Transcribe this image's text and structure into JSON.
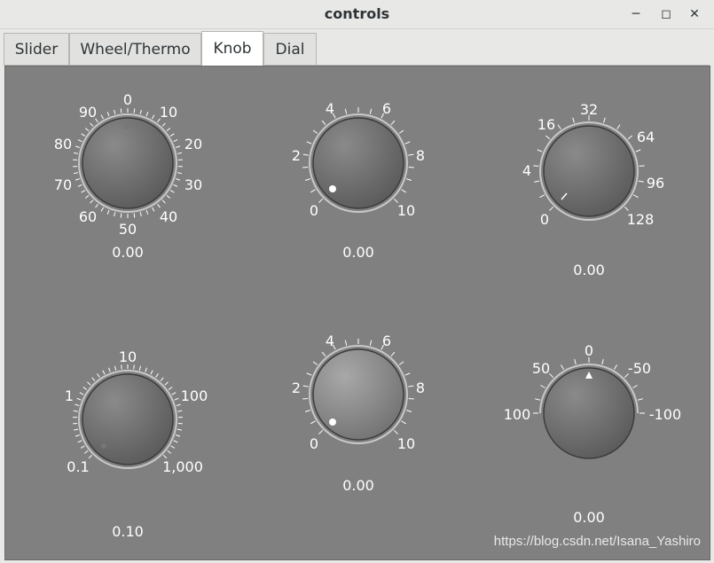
{
  "window": {
    "title": "controls",
    "minimize_icon": "minimize-icon",
    "maximize_icon": "maximize-icon",
    "close_icon": "close-icon"
  },
  "tabs": [
    {
      "label": "Slider",
      "active": false
    },
    {
      "label": "Wheel/Thermo",
      "active": false
    },
    {
      "label": "Knob",
      "active": true
    },
    {
      "label": "Dial",
      "active": false
    }
  ],
  "knobs": [
    {
      "value_text": "0.00",
      "scale_labels": [
        "0",
        "10",
        "20",
        "30",
        "40",
        "50",
        "60",
        "70",
        "80",
        "90"
      ]
    },
    {
      "value_text": "0.00",
      "scale_labels": [
        "0",
        "2",
        "4",
        "6",
        "8",
        "10"
      ]
    },
    {
      "value_text": "0.00",
      "scale_labels": [
        "0",
        "4",
        "16",
        "32",
        "64",
        "96",
        "128"
      ]
    },
    {
      "value_text": "0.10",
      "scale_labels": [
        "0.1",
        "1",
        "10",
        "100",
        "1,000"
      ]
    },
    {
      "value_text": "0.00",
      "scale_labels": [
        "0",
        "2",
        "4",
        "6",
        "8",
        "10"
      ]
    },
    {
      "value_text": "0.00",
      "scale_labels": [
        "100",
        "50",
        "0",
        "-50",
        "-100"
      ]
    }
  ],
  "watermark": "https://blog.csdn.net/Isana_Yashiro",
  "colors": {
    "panel": "#808080",
    "tick": "#ffffff",
    "knob_light": "#b0b0b0",
    "knob_dark": "#5a5a5a"
  }
}
